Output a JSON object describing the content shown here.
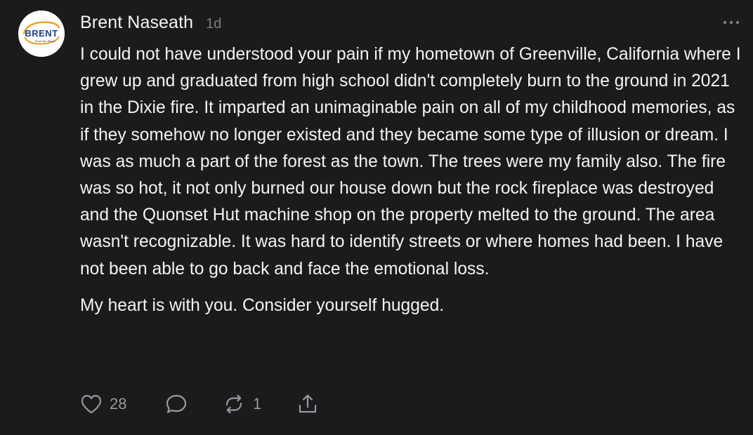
{
  "comment": {
    "author": "Brent Naseath",
    "avatar": {
      "logo_text": "BRENT",
      "logo_subtext": "From the Heart",
      "colors": {
        "primary": "#1c3f94",
        "accent": "#f0a11a"
      }
    },
    "time": "1d",
    "more_icon": "ellipsis-icon",
    "paragraphs": [
      "I could not have understood your pain if my hometown of Greenville, California where I grew up and graduated from high school didn't completely burn to the ground in 2021 in the Dixie fire. It imparted an unimaginable pain on all of my childhood memories, as if they somehow no longer existed and they became some type of illusion or dream. I was as much a part of the forest as the town. The trees were my family also. The fire was so hot, it not only burned our house down but the rock fireplace was destroyed and the Quonset Hut machine shop on the property melted to the ground. The area wasn't recognizable. It was hard to identify streets or where homes had been. I have not been able to go back and face the emotional loss.",
      "My heart is with you. Consider yourself hugged."
    ],
    "actions": {
      "like": {
        "icon": "heart-icon",
        "count": "28"
      },
      "reply": {
        "icon": "comment-bubble-icon"
      },
      "restack": {
        "icon": "restack-icon",
        "count": "1"
      },
      "share": {
        "icon": "share-icon"
      }
    }
  },
  "colors": {
    "background": "#1b1b1d",
    "text": "#f4f4f4",
    "muted": "#9a9a9e"
  }
}
